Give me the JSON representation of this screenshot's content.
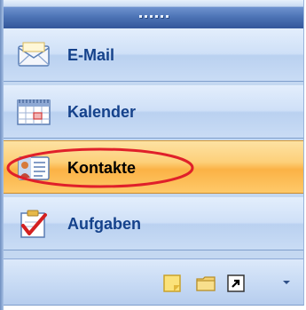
{
  "nav": {
    "items": [
      {
        "label": "E-Mail",
        "icon": "envelope-icon",
        "active": false
      },
      {
        "label": "Kalender",
        "icon": "calendar-icon",
        "active": false
      },
      {
        "label": "Kontakte",
        "icon": "contacts-card-icon",
        "active": true
      },
      {
        "label": "Aufgaben",
        "icon": "task-clipboard-check-icon",
        "active": false
      }
    ]
  },
  "bottom_bar": {
    "buttons": [
      {
        "icon": "notes-icon"
      },
      {
        "icon": "folder-icon"
      },
      {
        "icon": "shortcut-arrow-icon"
      },
      {
        "icon": "configure-buttons-chevron-icon"
      }
    ]
  },
  "colors": {
    "panel_blue": "#c4d8f1",
    "splitter_blue": "#4d74b6",
    "active_orange": "#fbb245",
    "label_blue": "#15428b",
    "highlight_red": "#e0202a"
  }
}
